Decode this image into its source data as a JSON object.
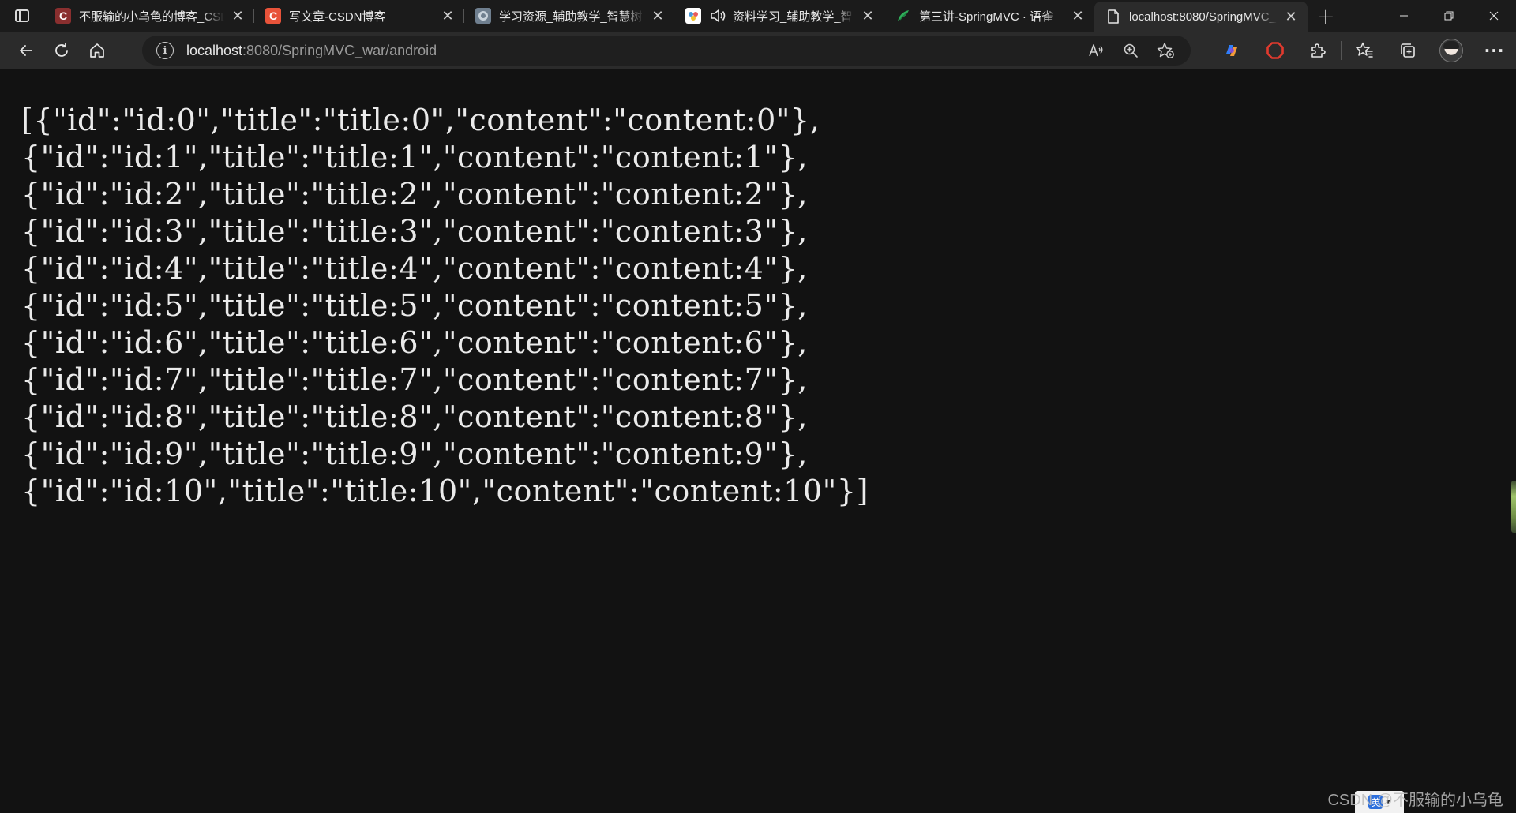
{
  "browser": {
    "tabs": [
      {
        "label": "不服输的小乌龟的博客_CSD",
        "favicon_text": "C",
        "favicon_color": "#8a2f2f",
        "active": false
      },
      {
        "label": "写文章-CSDN博客",
        "favicon_text": "C",
        "favicon_color": "#e8533a",
        "active": false
      },
      {
        "label": "学习资源_辅助教学_智慧树",
        "favicon_text": "",
        "favicon_color": "#6f7f8f",
        "active": false
      },
      {
        "label": "资料学习_辅助教学_智",
        "favicon_text": "",
        "favicon_color": "#ffffff",
        "active": false
      },
      {
        "label": "第三讲-SpringMVC · 语雀",
        "favicon_text": "",
        "favicon_color": "#2fae5a",
        "active": false
      },
      {
        "label": "localhost:8080/SpringMVC_",
        "favicon_text": "",
        "favicon_color": "#2b2b2b",
        "active": true
      }
    ],
    "new_tab_symbol": "+",
    "address": {
      "host": "localhost",
      "path": ":8080/SpringMVC_war/android",
      "info_symbol": "i"
    },
    "icons": {
      "back": "back-arrow-icon",
      "refresh": "refresh-icon",
      "home": "home-icon",
      "read_aloud": "read-aloud-icon",
      "zoom": "zoom-icon",
      "favorite_add": "add-favorite-icon",
      "extension1": "copilot-icon",
      "extension2": "adblock-icon",
      "extensions": "extensions-icon",
      "favorites": "favorites-icon",
      "collections": "collections-icon",
      "profile": "profile-avatar",
      "more": "more-icon"
    },
    "more_symbol": "···"
  },
  "page": {
    "json_lines": [
      "[{\"id\":\"id:0\",\"title\":\"title:0\",\"content\":\"content:0\"},",
      "{\"id\":\"id:1\",\"title\":\"title:1\",\"content\":\"content:1\"},",
      "{\"id\":\"id:2\",\"title\":\"title:2\",\"content\":\"content:2\"},",
      "{\"id\":\"id:3\",\"title\":\"title:3\",\"content\":\"content:3\"},",
      "{\"id\":\"id:4\",\"title\":\"title:4\",\"content\":\"content:4\"},",
      "{\"id\":\"id:5\",\"title\":\"title:5\",\"content\":\"content:5\"},",
      "{\"id\":\"id:6\",\"title\":\"title:6\",\"content\":\"content:6\"},",
      "{\"id\":\"id:7\",\"title\":\"title:7\",\"content\":\"content:7\"},",
      "{\"id\":\"id:8\",\"title\":\"title:8\",\"content\":\"content:8\"},",
      "{\"id\":\"id:9\",\"title\":\"title:9\",\"content\":\"content:9\"},",
      "{\"id\":\"id:10\",\"title\":\"title:10\",\"content\":\"content:10\"}]"
    ]
  },
  "watermark": {
    "text": "CSDN @不服输的小乌龟"
  },
  "ime": {
    "char": "英"
  },
  "colors": {
    "page_bg": "#121212",
    "toolbar_bg": "#2b2b2b",
    "tabbar_bg": "#1b1b1b",
    "text": "#eaeaea"
  }
}
